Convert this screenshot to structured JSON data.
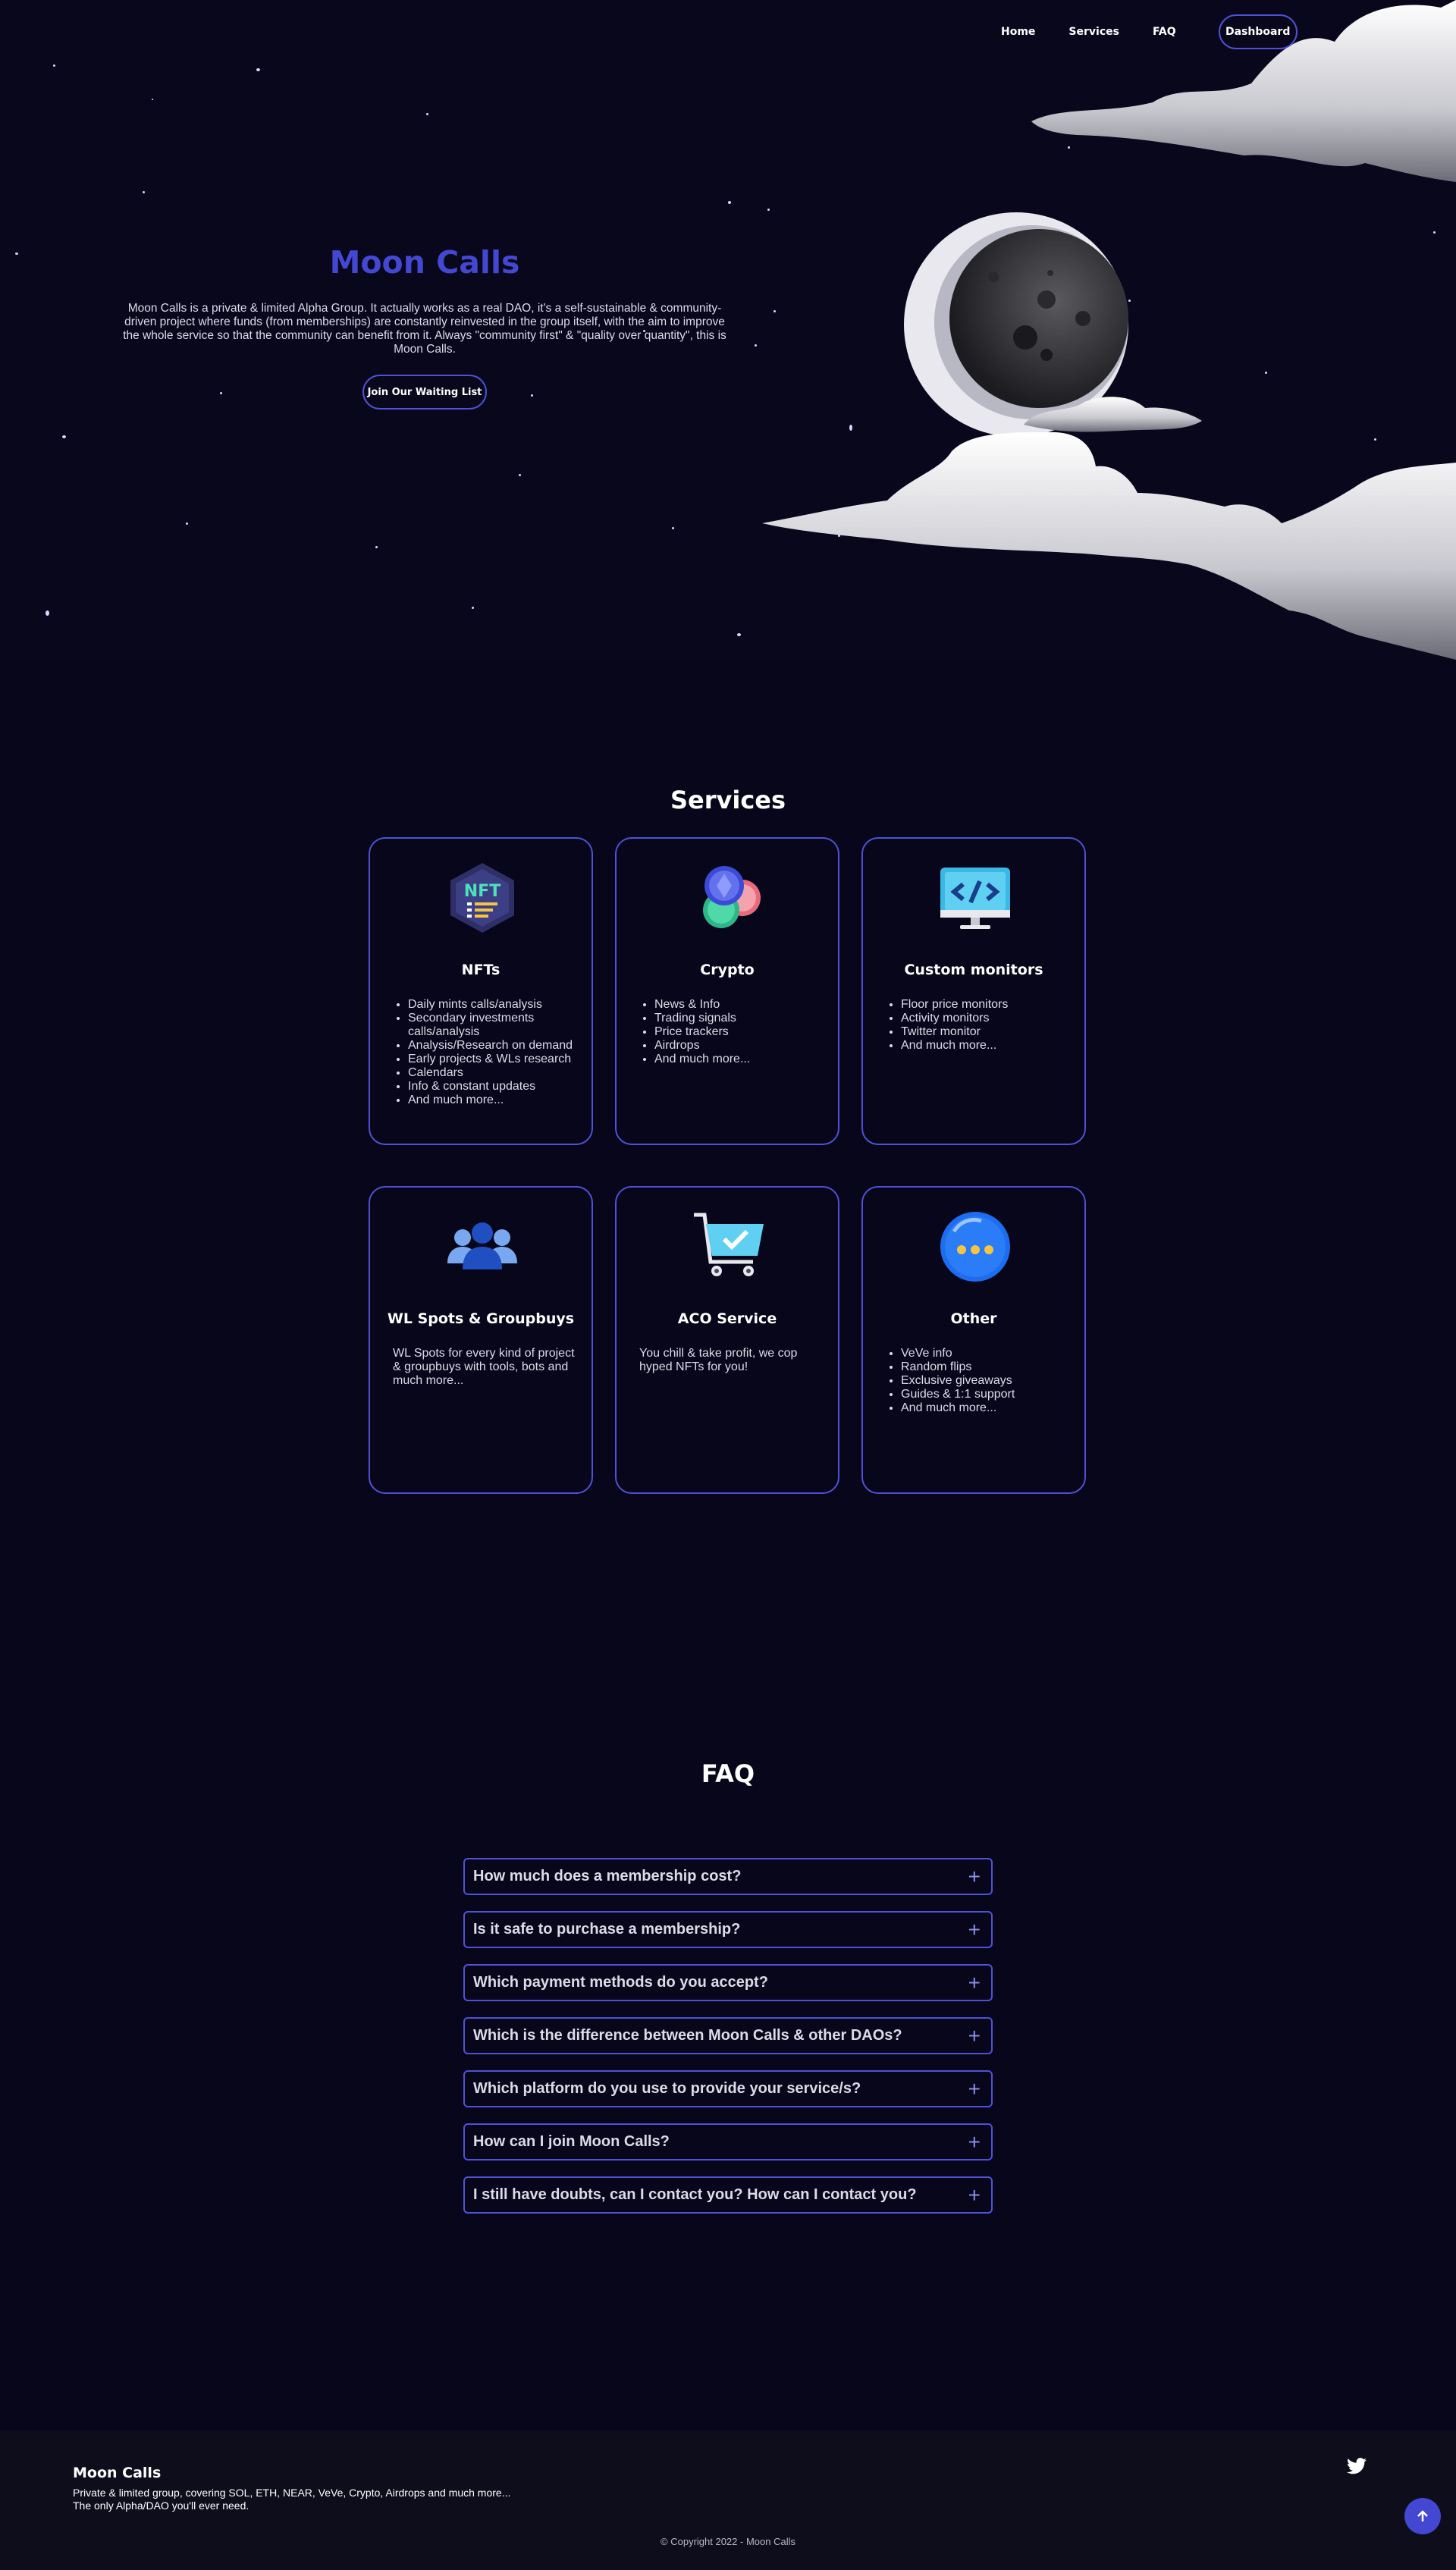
{
  "nav": {
    "links": [
      "Home",
      "Services",
      "FAQ"
    ],
    "cta": "Dashboard"
  },
  "hero": {
    "title": "Moon Calls",
    "description": "Moon Calls is a private & limited Alpha Group. It actually works as a real DAO, it's a self-sustainable & community-driven project where funds (from memberships) are constantly reinvested in the group itself, with the aim to improve the whole service so that the community can benefit from it. Always \"community first\" & \"quality over quantity\", this is Moon Calls.",
    "cta": "Join Our Waiting List"
  },
  "services": {
    "title": "Services",
    "cards": [
      {
        "title": "NFTs",
        "icon": "nft-hexagon-icon",
        "items": [
          "Daily mints calls/analysis",
          "Secondary investments calls/analysis",
          "Analysis/Research on demand",
          "Early projects & WLs research",
          "Calendars",
          "Info & constant updates",
          "And much more..."
        ]
      },
      {
        "title": "Crypto",
        "icon": "crypto-coins-icon",
        "items": [
          "News & Info",
          "Trading signals",
          "Price trackers",
          "Airdrops",
          "And much more..."
        ]
      },
      {
        "title": "Custom monitors",
        "icon": "code-monitor-icon",
        "items": [
          "Floor price monitors",
          "Activity monitors",
          "Twitter monitor",
          "And much more..."
        ]
      },
      {
        "title": "WL Spots & Groupbuys",
        "icon": "group-users-icon",
        "text": "WL Spots for every kind of project & groupbuys with tools, bots and much more..."
      },
      {
        "title": "ACO Service",
        "icon": "shopping-cart-icon",
        "text": "You chill & take profit, we cop hyped NFTs for you!"
      },
      {
        "title": "Other",
        "icon": "chat-bubble-icon",
        "items": [
          "VeVe info",
          "Random flips",
          "Exclusive giveaways",
          "Guides & 1:1 support",
          "And much more..."
        ]
      }
    ]
  },
  "faq": {
    "title": "FAQ",
    "questions": [
      "How much does a membership cost?",
      "Is it safe to purchase a membership?",
      "Which payment methods do you accept?",
      "Which is the difference between Moon Calls & other DAOs?",
      "Which platform do you use to provide your service/s?",
      "How can I join Moon Calls?",
      "I still have doubts, can I contact you? How can I contact you?"
    ]
  },
  "footer": {
    "brand": "Moon Calls",
    "line1": "Private & limited group, covering SOL, ETH, NEAR, VeVe, Crypto, Airdrops and much more...",
    "line2": "The only Alpha/DAO you'll ever need.",
    "copyright": "© Copyright 2022 - Moon Calls"
  },
  "colors": {
    "accent": "#4f52d6",
    "title": "#4447d1",
    "background": "#07061a",
    "footer": "#0d0d1c"
  }
}
